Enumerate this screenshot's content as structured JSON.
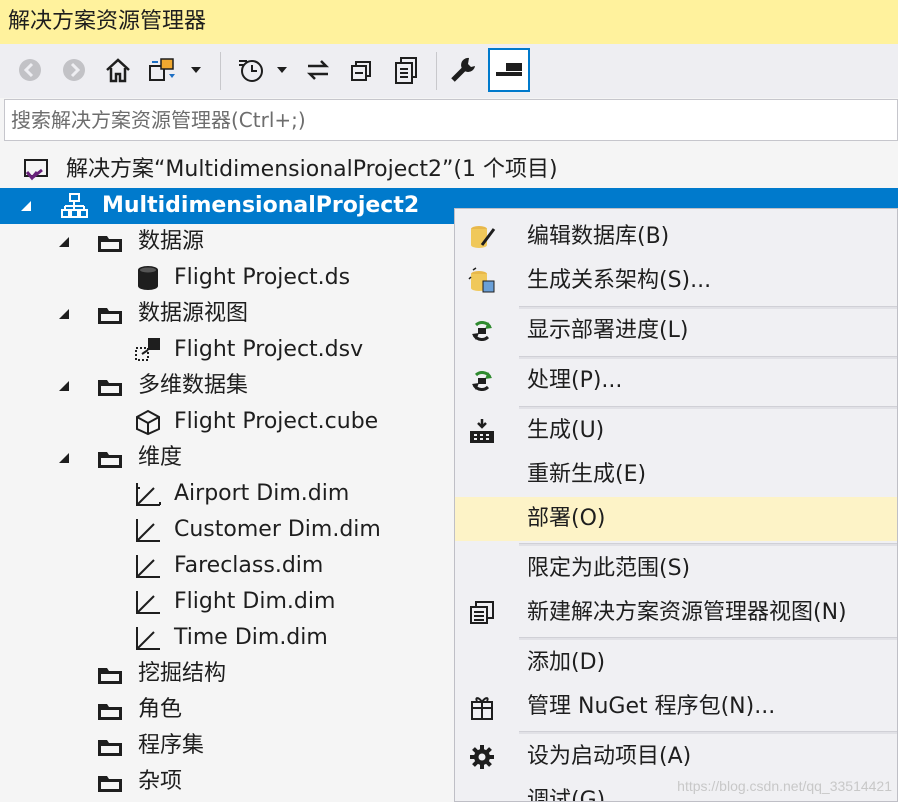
{
  "window": {
    "title": "解决方案资源管理器"
  },
  "search": {
    "placeholder": "搜索解决方案资源管理器(Ctrl+;)"
  },
  "tree": {
    "solution_label": "解决方案“MultidimensionalProject2”(1 个项目)",
    "project_label": "MultidimensionalProject2",
    "folders": {
      "datasource": "数据源",
      "dsv": "数据源视图",
      "cubes": "多维数据集",
      "dimensions": "维度",
      "mining": "挖掘结构",
      "roles": "角色",
      "assemblies": "程序集",
      "misc": "杂项"
    },
    "files": {
      "ds": "Flight Project.ds",
      "dsv": "Flight Project.dsv",
      "cube": "Flight Project.cube",
      "dim1": "Airport Dim.dim",
      "dim2": "Customer Dim.dim",
      "dim3": "Fareclass.dim",
      "dim4": "Flight Dim.dim",
      "dim5": "Time Dim.dim"
    }
  },
  "context_menu": {
    "edit_db": "编辑数据库(B)",
    "gen_schema": "生成关系架构(S)...",
    "show_deploy": "显示部署进度(L)",
    "process": "处理(P)...",
    "build": "生成(U)",
    "rebuild": "重新生成(E)",
    "deploy": "部署(O)",
    "scope": "限定为此范围(S)",
    "new_view": "新建解决方案资源管理器视图(N)",
    "add": "添加(D)",
    "nuget": "管理 NuGet 程序包(N)...",
    "startup": "设为启动项目(A)",
    "debug": "调试(G)"
  },
  "watermark": "https://blog.csdn.net/qq_33514421",
  "colors": {
    "title_bg": "#fff29d",
    "selection": "#007acc",
    "menu_highlight": "#fdf3c7"
  }
}
